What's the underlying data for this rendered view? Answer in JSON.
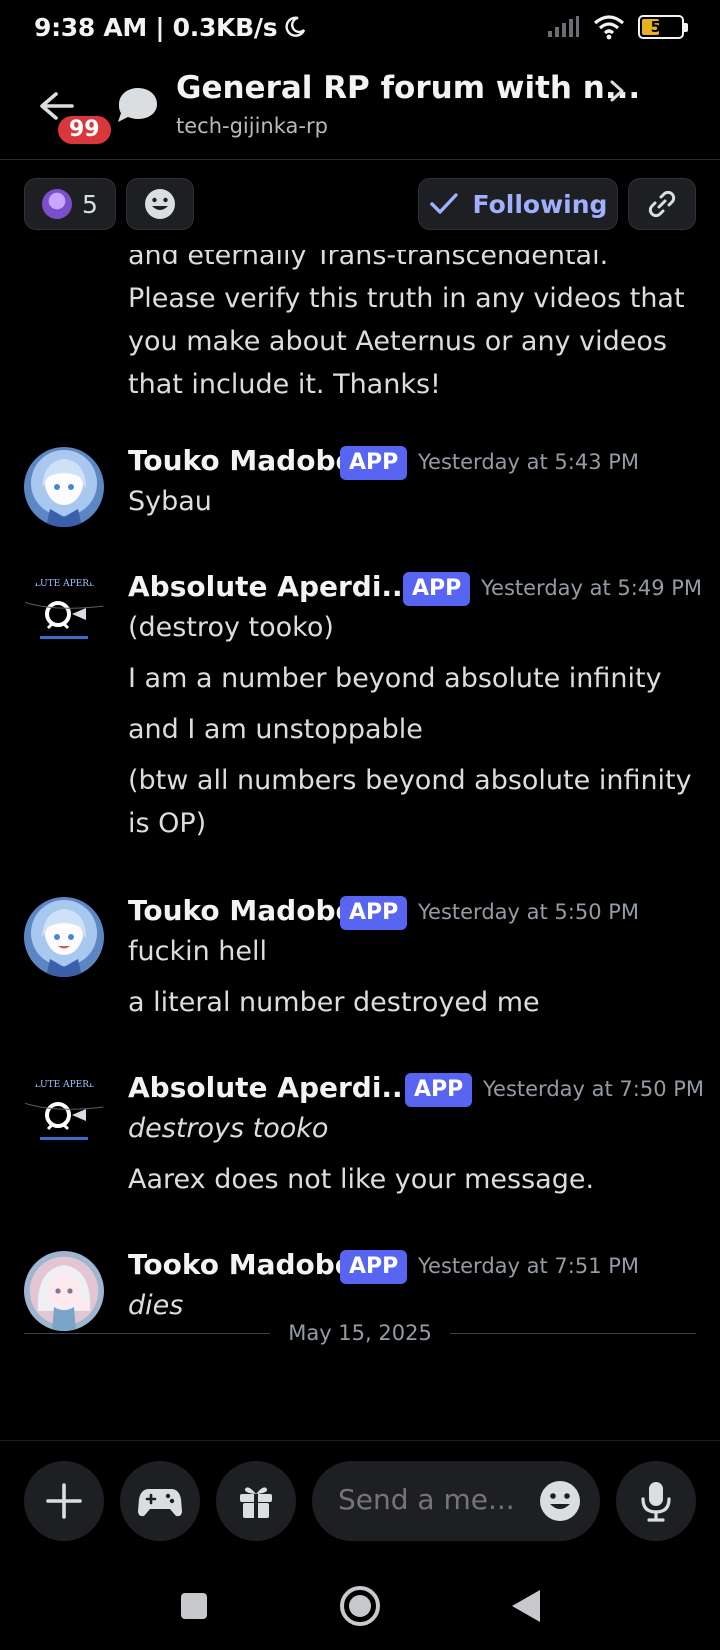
{
  "status_bar": {
    "time_speed": "9:38 AM | 0.3KB/s",
    "battery": "51",
    "battery_level": 0.51
  },
  "header": {
    "notification_count": "99",
    "title": "General RP forum with n...",
    "subtitle": "tech-gijinka-rp"
  },
  "toolbar": {
    "member_count": "5",
    "following_label": "Following"
  },
  "continuation_lines": [
    "and eternally Trans-transcendental.",
    "Please verify this truth in any videos that",
    "you make about Aeternus or any videos",
    "that include it. Thanks!"
  ],
  "messages": [
    {
      "author": "Touko Madobe",
      "tag": "APP",
      "timestamp": "Yesterday at 5:43 PM",
      "lines": [
        "Sybau"
      ]
    },
    {
      "author": "Absolute Aperdi...",
      "tag": "APP",
      "timestamp": "Yesterday at 5:49 PM",
      "avatar_text": "ABSOLUTE APERDINAL",
      "lines": [
        "(destroy tooko)",
        "I am a number beyond absolute infinity",
        "and I am unstoppable",
        "(btw all numbers beyond absolute infinity",
        "is OP)"
      ]
    },
    {
      "author": "Touko Madobe",
      "tag": "APP",
      "timestamp": "Yesterday at 5:50 PM",
      "lines": [
        "fuckin hell",
        "a literal number destroyed me"
      ]
    },
    {
      "author": "Absolute Aperdi...",
      "tag": "APP",
      "timestamp": "Yesterday at 7:50 PM",
      "avatar_text": "ABSOLUTE APERDINAL",
      "lines": [
        "destroys tooko",
        "Aarex does not like your message."
      ]
    },
    {
      "author": "Tooko Madobe",
      "tag": "APP",
      "timestamp": "Yesterday at 7:51 PM",
      "lines": [
        "dies"
      ]
    }
  ],
  "date_separator": "May 15, 2025",
  "composer": {
    "placeholder": "Send a me..."
  },
  "colors": {
    "background": "#000000",
    "accent": "#5865f2",
    "badge": "#da373c",
    "text_muted": "#949ba4"
  },
  "icons": [
    "back-arrow-icon",
    "thread-bubble-icon",
    "chevron-right-icon",
    "emoji-icon",
    "check-icon",
    "link-icon",
    "plus-icon",
    "gamepad-icon",
    "gift-icon",
    "microphone-icon",
    "square-icon",
    "circle-icon",
    "triangle-back-icon"
  ]
}
